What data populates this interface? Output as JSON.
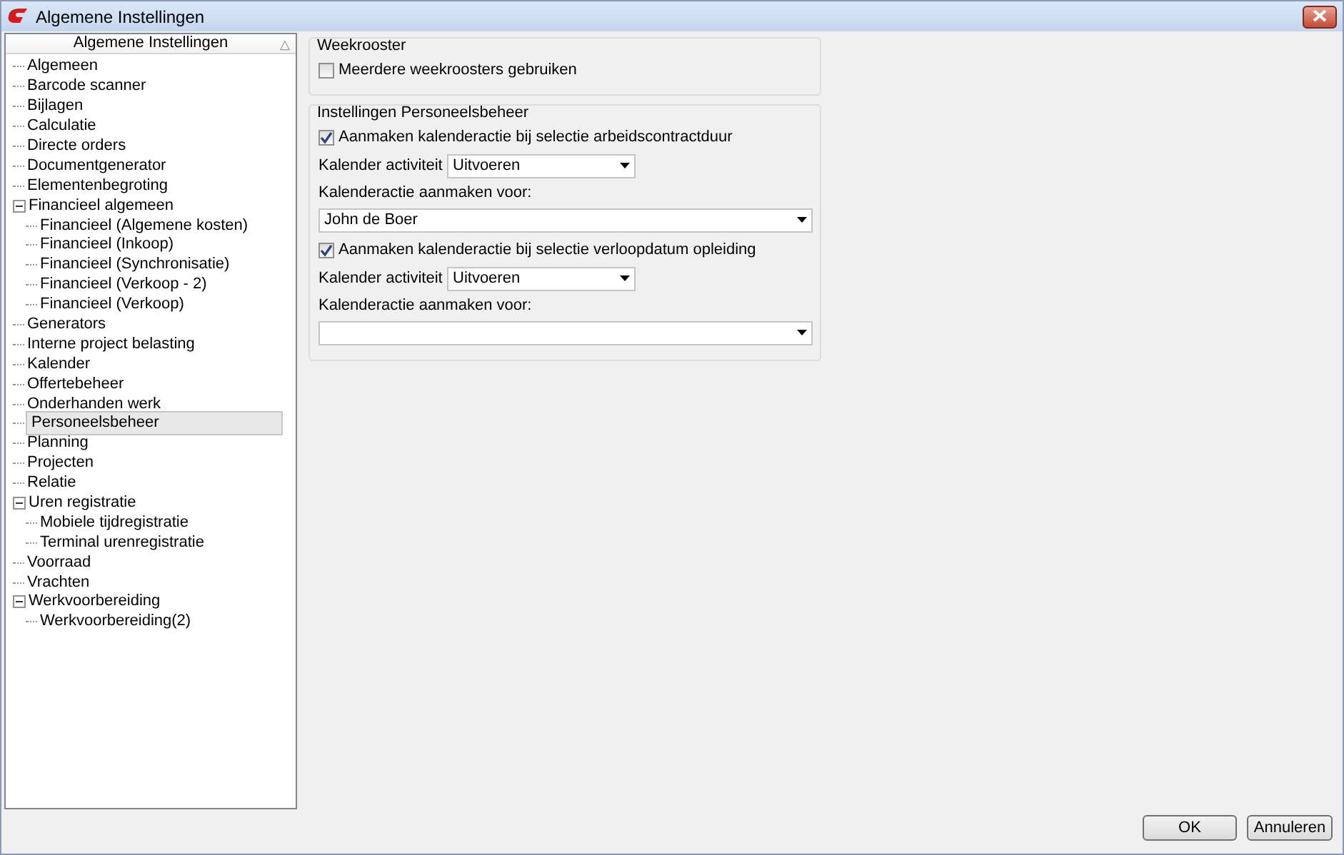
{
  "window": {
    "title": "Algemene Instellingen"
  },
  "tree": {
    "header": "Algemene Instellingen",
    "sort_glyph": "△",
    "items": [
      {
        "label": "Algemeen",
        "selected": false
      },
      {
        "label": "Barcode scanner",
        "selected": false
      },
      {
        "label": "Bijlagen",
        "selected": false
      },
      {
        "label": "Calculatie",
        "selected": false
      },
      {
        "label": "Directe orders",
        "selected": false
      },
      {
        "label": "Documentgenerator",
        "selected": false
      },
      {
        "label": "Elementenbegroting",
        "selected": false
      },
      {
        "label": "Financieel algemeen",
        "selected": false,
        "expanded": true,
        "children": [
          {
            "label": "Financieel (Algemene kosten)",
            "selected": false
          },
          {
            "label": "Financieel (Inkoop)",
            "selected": false
          },
          {
            "label": "Financieel (Synchronisatie)",
            "selected": false
          },
          {
            "label": "Financieel (Verkoop - 2)",
            "selected": false
          },
          {
            "label": "Financieel (Verkoop)",
            "selected": false
          }
        ]
      },
      {
        "label": "Generators",
        "selected": false
      },
      {
        "label": "Interne project belasting",
        "selected": false
      },
      {
        "label": "Kalender",
        "selected": false
      },
      {
        "label": "Offertebeheer",
        "selected": false
      },
      {
        "label": "Onderhanden werk",
        "selected": false
      },
      {
        "label": "Personeelsbeheer",
        "selected": true
      },
      {
        "label": "Planning",
        "selected": false
      },
      {
        "label": "Projecten",
        "selected": false
      },
      {
        "label": "Relatie",
        "selected": false
      },
      {
        "label": "Uren registratie",
        "selected": false,
        "expanded": true,
        "children": [
          {
            "label": "Mobiele tijdregistratie",
            "selected": false
          },
          {
            "label": "Terminal urenregistratie",
            "selected": false
          }
        ]
      },
      {
        "label": "Voorraad",
        "selected": false
      },
      {
        "label": "Vrachten",
        "selected": false
      },
      {
        "label": "Werkvoorbereiding",
        "selected": false,
        "expanded": true,
        "children": [
          {
            "label": "Werkvoorbereiding(2)",
            "selected": false
          }
        ]
      }
    ]
  },
  "groups": [
    {
      "title": "Weekrooster",
      "rows": [
        {
          "kind": "checkbox",
          "label": "Meerdere weekroosters gebruiken",
          "checked": false
        }
      ]
    },
    {
      "title": "Instellingen Personeelsbeheer",
      "rows": [
        {
          "kind": "checkbox",
          "label": "Aanmaken kalenderactie bij selectie arbeidscontractduur",
          "checked": true
        },
        {
          "kind": "inline-select",
          "label": "Kalender activiteit",
          "value": "Uitvoeren"
        },
        {
          "kind": "label",
          "label": "Kalenderactie aanmaken voor:"
        },
        {
          "kind": "wide-select",
          "value": "John de Boer"
        },
        {
          "kind": "checkbox",
          "label": "Aanmaken kalenderactie bij selectie verloopdatum opleiding",
          "checked": true
        },
        {
          "kind": "inline-select",
          "label": "Kalender activiteit",
          "value": "Uitvoeren"
        },
        {
          "kind": "label",
          "label": "Kalenderactie aanmaken voor:"
        },
        {
          "kind": "wide-select"
        }
      ]
    }
  ],
  "buttons": [
    "OK",
    "Annuleren"
  ]
}
